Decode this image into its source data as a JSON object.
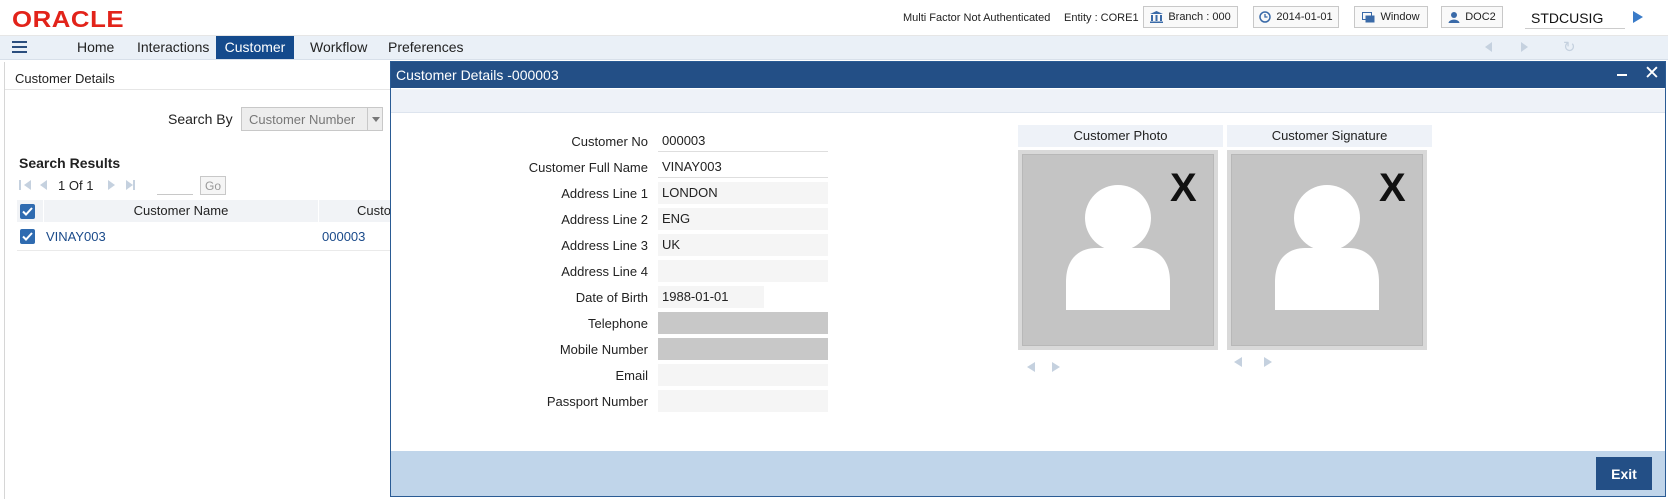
{
  "header": {
    "logo": "ORACLE",
    "mfa_status": "Multi Factor Not Authenticated",
    "entity": "Entity : CORE1",
    "branch": "Branch : 000",
    "date": "2014-01-01",
    "window": "Window",
    "user": "DOC2",
    "function_id": "STDCUSIG"
  },
  "nav": {
    "items": [
      "Home",
      "Interactions",
      "Customer",
      "Workflow",
      "Preferences"
    ],
    "active": "Customer"
  },
  "screen": {
    "title": "Customer Details",
    "search_by_label": "Search By",
    "search_by_value": "Customer Number",
    "results_title": "Search Results",
    "pagination": {
      "current": "1",
      "of_label": "Of",
      "total": "1",
      "go_label": "Go"
    },
    "columns": [
      "Customer Name",
      "Custo"
    ],
    "rows": [
      {
        "name": "VINAY003",
        "number": "000003",
        "checked": true
      }
    ]
  },
  "modal": {
    "title": "Customer Details -000003",
    "fields": [
      {
        "label": "Customer No",
        "value": "000003"
      },
      {
        "label": "Customer Full Name",
        "value": "VINAY003"
      },
      {
        "label": "Address Line 1",
        "value": "LONDON"
      },
      {
        "label": "Address Line 2",
        "value": "ENG"
      },
      {
        "label": "Address Line 3",
        "value": "UK"
      },
      {
        "label": "Address Line 4",
        "value": ""
      },
      {
        "label": "Date of Birth",
        "value": "1988-01-01"
      },
      {
        "label": "Telephone",
        "value": ""
      },
      {
        "label": "Mobile Number",
        "value": ""
      },
      {
        "label": "Email",
        "value": ""
      },
      {
        "label": "Passport Number",
        "value": ""
      }
    ],
    "photo_title": "Customer Photo",
    "signature_title": "Customer Signature",
    "exit_label": "Exit"
  },
  "colors": {
    "brand_red": "#e2231a",
    "nav_active": "#144a8c",
    "modal_header": "#234f86",
    "footer": "#c0d5ea"
  },
  "icons": [
    "menu-icon",
    "bank-icon",
    "clock-icon",
    "window-icon",
    "user-icon",
    "arrow-right-icon",
    "refresh-icon",
    "checkbox-icon",
    "minimize-icon",
    "close-icon",
    "placeholder-person-icon"
  ]
}
